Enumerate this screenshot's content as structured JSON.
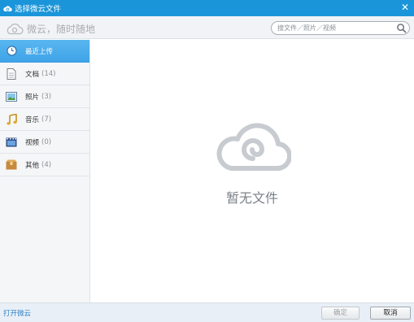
{
  "window": {
    "title": "选择微云文件",
    "close_symbol": "✕"
  },
  "toolbar": {
    "slogan": "微云，随时随地",
    "search": {
      "placeholder": "搜文件／照片／视频",
      "icon": "search-icon"
    }
  },
  "sidebar": {
    "items": [
      {
        "label": "最近上传",
        "count": "",
        "icon": "clock-icon",
        "active": true
      },
      {
        "label": "文档",
        "count": "(14)",
        "icon": "document-icon",
        "active": false
      },
      {
        "label": "照片",
        "count": "(3)",
        "icon": "photo-icon",
        "active": false
      },
      {
        "label": "音乐",
        "count": "(7)",
        "icon": "music-icon",
        "active": false
      },
      {
        "label": "视频",
        "count": "(0)",
        "icon": "video-icon",
        "active": false
      },
      {
        "label": "其他",
        "count": "(4)",
        "icon": "box-icon",
        "active": false
      }
    ]
  },
  "main": {
    "empty_text": "暂无文件"
  },
  "footer": {
    "open_link": "打开微云",
    "ok_label": "确定",
    "cancel_label": "取消"
  },
  "colors": {
    "accent": "#1b95d9",
    "active_item": "#4aaeed",
    "link": "#2a7fc6"
  }
}
